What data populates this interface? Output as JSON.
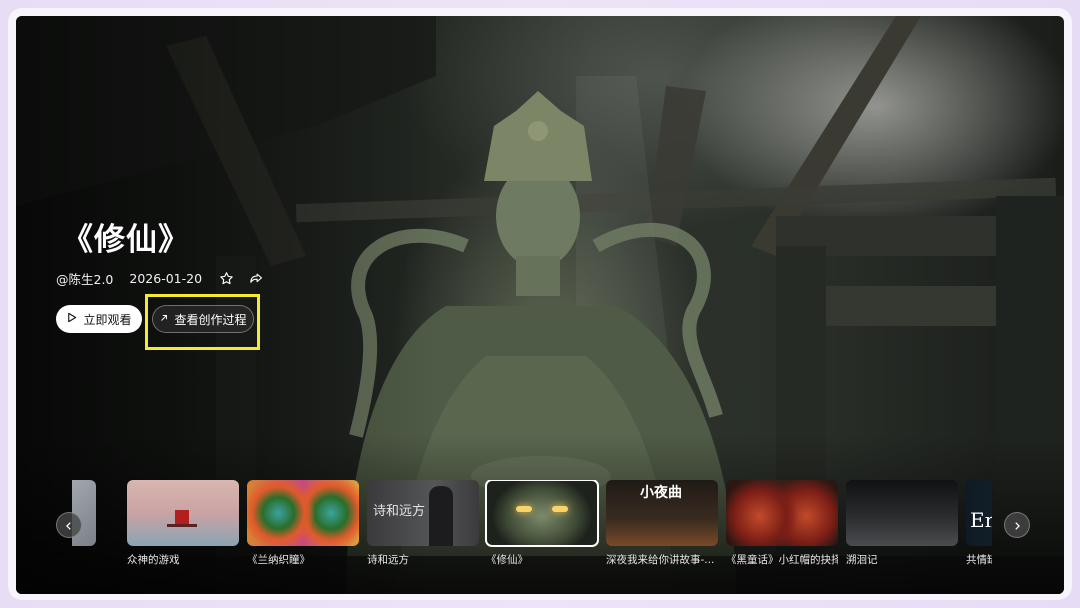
{
  "hero": {
    "title": "《修仙》",
    "author": "@陈生2.0",
    "date": "2026-01-20",
    "favorite_icon": "star-icon",
    "share_icon": "share-icon"
  },
  "actions": {
    "watch_label": "立即观看",
    "watch_icon": "play-icon",
    "process_label": "查看创作过程",
    "process_icon": "arrow-up-right-icon"
  },
  "colors": {
    "highlight": "#f4ea2e",
    "frame_bg": "#ebdff7"
  },
  "carousel": {
    "prev_icon": "chevron-left-icon",
    "next_icon": "chevron-right-icon",
    "items": [
      {
        "label": "",
        "active": false
      },
      {
        "label": "众神的游戏",
        "active": false
      },
      {
        "label": "《兰纳织瞳》",
        "active": false
      },
      {
        "label": "诗和远方",
        "thumb_text": "诗和远方",
        "active": false
      },
      {
        "label": "《修仙》",
        "active": true
      },
      {
        "label": "深夜我来给你讲故事-...",
        "thumb_text": "小夜曲",
        "active": false
      },
      {
        "label": "《黑童话》小红帽的抉择",
        "active": false
      },
      {
        "label": "溯洄记",
        "active": false
      },
      {
        "label": "共情缺",
        "thumb_text": "Em",
        "active": false
      }
    ]
  }
}
